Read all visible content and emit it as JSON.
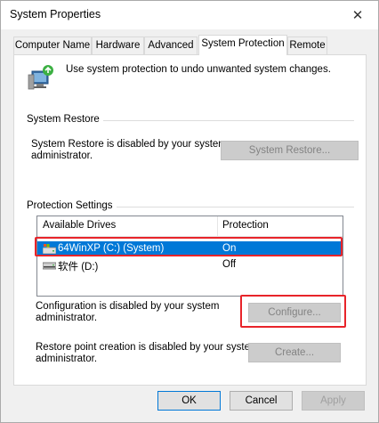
{
  "window": {
    "title": "System Properties",
    "close_label": "✕"
  },
  "tabs": [
    {
      "label": "Computer Name",
      "active": false
    },
    {
      "label": "Hardware",
      "active": false
    },
    {
      "label": "Advanced",
      "active": false
    },
    {
      "label": "System Protection",
      "active": true
    },
    {
      "label": "Remote",
      "active": false
    }
  ],
  "intro": {
    "text": "Use system protection to undo unwanted system changes.",
    "icon": "system-protection-icon"
  },
  "system_restore": {
    "group_title": "System Restore",
    "description_line1": "System Restore is disabled by your system",
    "description_line2": "administrator.",
    "button_label": "System Restore..."
  },
  "protection_settings": {
    "group_title": "Protection Settings",
    "columns": [
      "Available Drives",
      "Protection"
    ],
    "drives": [
      {
        "name": "64WinXP  (C:) (System)",
        "protection": "On",
        "selected": true,
        "icon": "system-drive-icon"
      },
      {
        "name": "软件 (D:)",
        "protection": "Off",
        "selected": false,
        "icon": "drive-icon"
      }
    ],
    "configure_text_line1": "Configuration is disabled by your system",
    "configure_text_line2": "administrator.",
    "configure_button": "Configure...",
    "create_text_line1": "Restore point creation is disabled by your system",
    "create_text_line2": "administrator.",
    "create_button": "Create..."
  },
  "footer": {
    "ok": "OK",
    "cancel": "Cancel",
    "apply": "Apply"
  },
  "colors": {
    "selection": "#0078d7",
    "highlight_annotation": "#e8242a"
  }
}
